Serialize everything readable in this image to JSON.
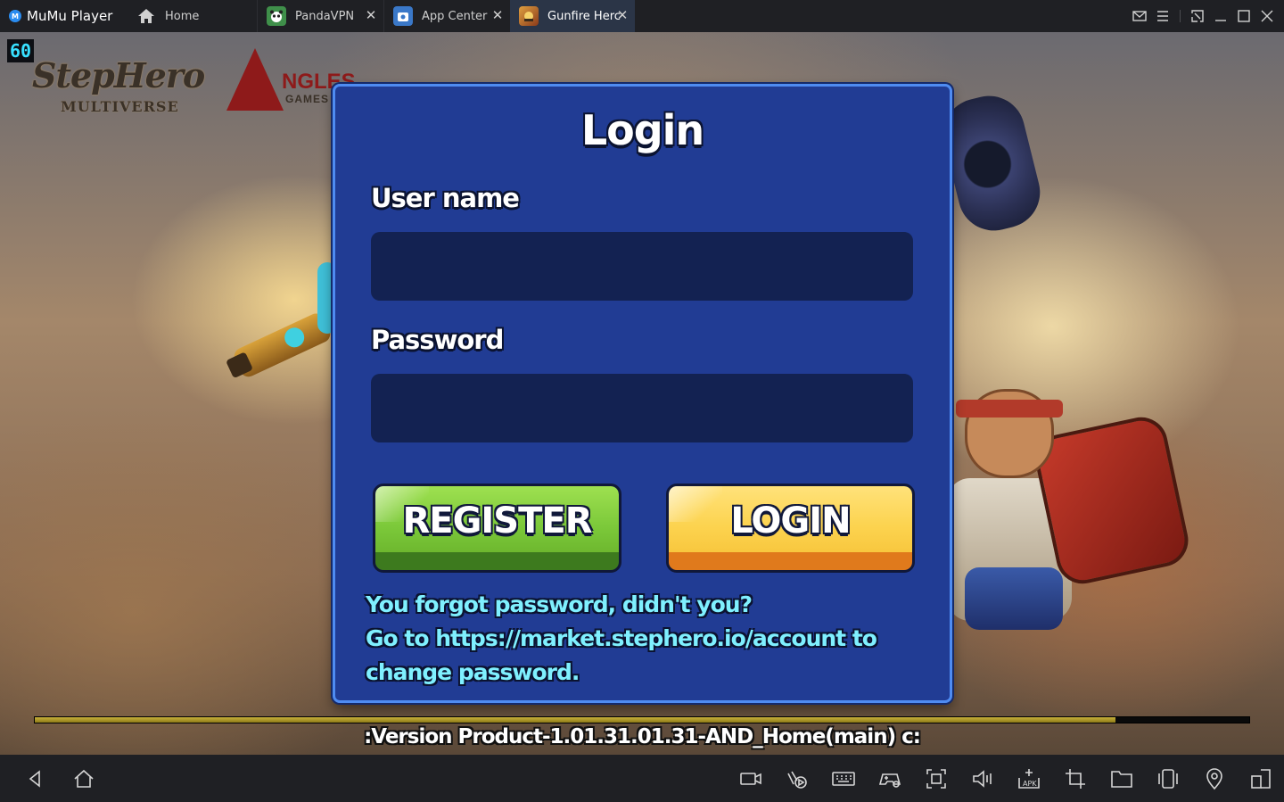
{
  "window": {
    "app_name": "MuMu Player",
    "tabs": [
      {
        "label": "Home",
        "icon": "home-icon"
      },
      {
        "label": "PandaVPN",
        "icon": "pandavpn-app-icon"
      },
      {
        "label": "App Center",
        "icon": "app-center-icon"
      },
      {
        "label": "Gunfire Herc",
        "icon": "gunfire-hero-app-icon",
        "active": true
      }
    ]
  },
  "game": {
    "fps": "60",
    "brand_logo": {
      "line1": "StepHero",
      "line2": "MULTIVERSE"
    },
    "studio_logo": {
      "line1": "NGLES",
      "line2": "GAMES"
    },
    "login": {
      "title": "Login",
      "username_label": "User name",
      "username_value": "",
      "password_label": "Password",
      "password_value": "",
      "register_button": "REGISTER",
      "login_button": "LOGIN",
      "forgot_line1": "You forgot password, didn't you?",
      "forgot_line2": "Go to https://market.stephero.io/account to",
      "forgot_line3": "change password."
    },
    "loading_progress_percent": 89,
    "version_text": ":Version Product-1.01.31.01.31-AND_Home(main) c:"
  },
  "bottom_bar": {
    "icons": [
      "back-icon",
      "home-icon",
      "screen-record-icon",
      "gamepad-macro-icon",
      "keyboard-icon",
      "gamepad-icon",
      "screenshot-icon",
      "volume-icon",
      "install-apk-icon",
      "crop-icon",
      "folder-icon",
      "shake-icon",
      "location-icon",
      "multi-window-icon"
    ]
  },
  "colors": {
    "dialog_bg": "#213c94",
    "dialog_border": "#4f8cf2",
    "input_bg": "#132252",
    "register_green": "#7cc93a",
    "login_yellow": "#fcd34f",
    "forgot_text": "#7ff0ff",
    "fps_text": "#38e0ff",
    "active_tab_bg": "#2b3547"
  }
}
